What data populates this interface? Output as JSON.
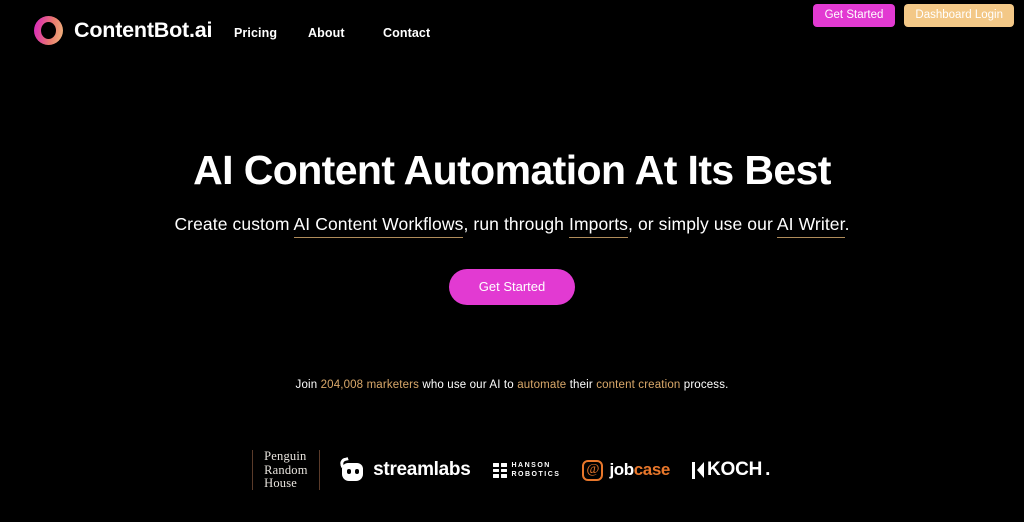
{
  "brand": {
    "name": "ContentBot.ai",
    "logo_icon": "gradient-ring-icon",
    "gradient_from": "#d726c4",
    "gradient_to": "#f0b87e"
  },
  "nav": {
    "items": [
      {
        "label": "Pricing"
      },
      {
        "label": "About"
      },
      {
        "label": "Contact"
      }
    ]
  },
  "header_actions": {
    "get_started_label": "Get Started",
    "get_started_color": "#e23ad2",
    "dashboard_login_label": "Dashboard Login",
    "dashboard_login_color": "#f3c887"
  },
  "hero": {
    "title": "AI Content Automation At Its Best",
    "subtitle": {
      "part1": "Create custom",
      "link1": "AI Content Workflows",
      "part2": ", run through",
      "link2": "Imports",
      "part3": ", or simply use our",
      "link3": "AI Writer",
      "part4": ".",
      "underline_color": "#b08c5a"
    },
    "cta_label": "Get Started",
    "cta_color": "#e23ad2"
  },
  "social_proof": {
    "prefix": "Join",
    "count": "204,008 marketers",
    "middle": "who use our AI to",
    "highlight2": "automate",
    "middle2": "their",
    "highlight3": "content creation",
    "suffix": "process.",
    "highlight_color": "#d9a86a"
  },
  "logos": {
    "items": [
      {
        "name": "Penguin Random House",
        "line1": "Penguin",
        "line2": "Random",
        "line3": "House"
      },
      {
        "name": "Streamlabs",
        "text": "streamlabs"
      },
      {
        "name": "Hanson Robotics",
        "line1": "HANSON",
        "line2": "ROBOTICS"
      },
      {
        "name": "jobcase",
        "text_white": "job",
        "text_orange": "case",
        "color": "#e8772b"
      },
      {
        "name": "KOCH",
        "text": "KOCH",
        "dot": "."
      }
    ]
  }
}
